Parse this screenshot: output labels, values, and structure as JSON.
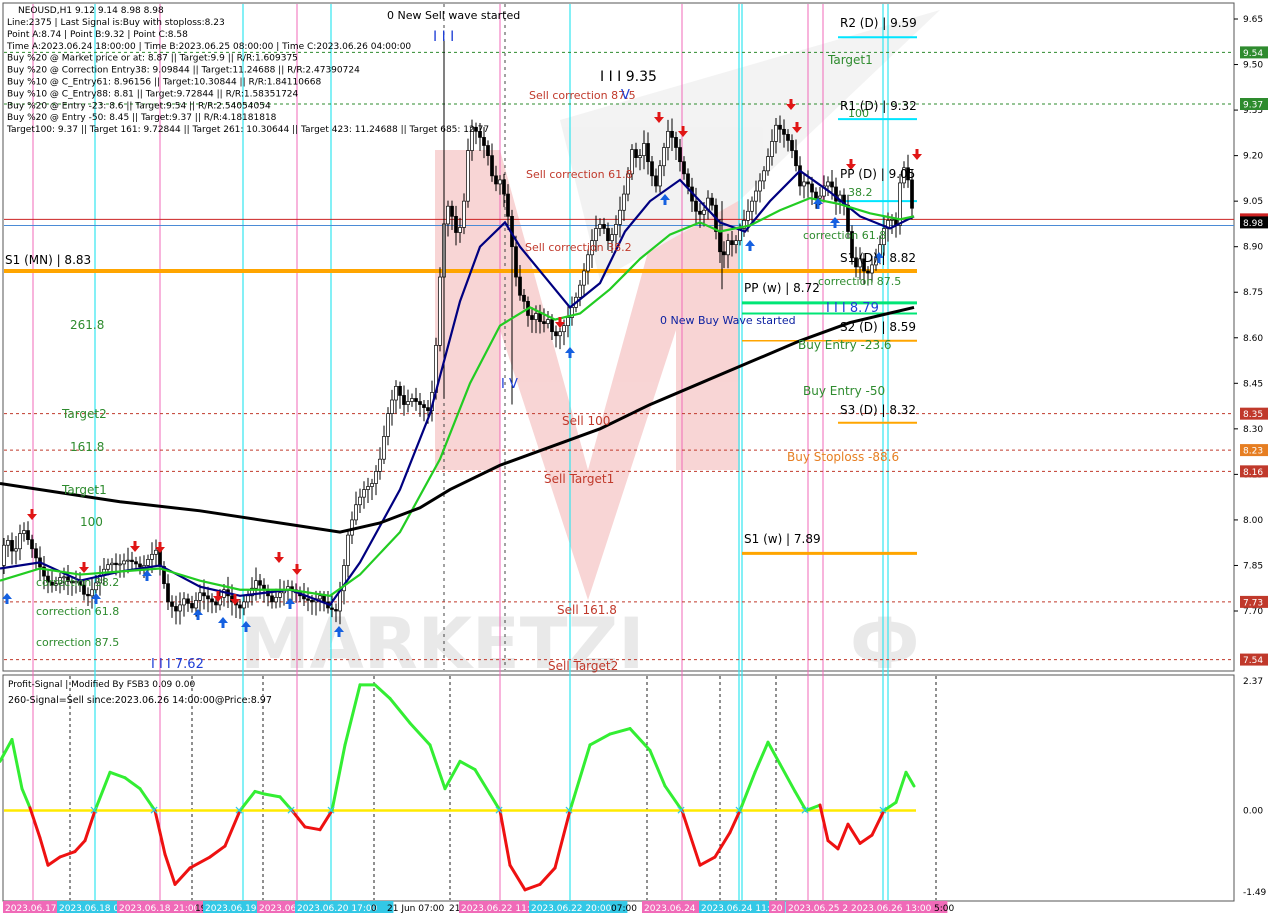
{
  "header": {
    "title": "NEOUSD,H1  9.12 9.14 8.98 8.98",
    "lines": [
      "Line:2375  | Last Signal is:Buy with stoploss:8.23",
      "Point A:8.74 | Point B:9.32 | Point C:8.58",
      "Time A:2023.06.24 18:00:00 | Time B:2023.06.25 08:00:00 | Time C:2023.06.26 04:00:00",
      "Buy %20 @ Market price or at: 8.87 || Target:9.9 || R/R:1.609375",
      "Buy %20 @ Correction Entry38: 9.09844 || Target:11.24688 || R/R:2.47390724",
      "Buy %10 @ C_Entry61: 8.96156 || Target:10.30844 || R/R:1.84110668",
      "Buy %10 @ C_Entry88: 8.81 || Target:9.72844 || R/R:1.58351724",
      "Buy %20 @ Entry -23: 8.6 || Target:9.54 || R/R:2.54054054",
      "Buy %20 @ Entry -50: 8.45 || Target:9.37 || R/R:4.18181818",
      "Target100: 9.37 || Target 161: 9.72844 || Target 261: 10.30644 || Target 423: 11.24688 || Target 685: 12.77"
    ]
  },
  "price_axis": {
    "ticks": [
      "9.65",
      "9.50",
      "9.35",
      "9.20",
      "9.05",
      "8.90",
      "8.75",
      "8.60",
      "8.45",
      "8.30",
      "8.15",
      "8.00",
      "7.85",
      "7.70"
    ],
    "badges": [
      {
        "label": "9.54",
        "value": 9.54,
        "color": "#2e8b2e"
      },
      {
        "label": "9.37",
        "value": 9.37,
        "color": "#2e8b2e"
      },
      {
        "label": "8.99",
        "value": 8.99,
        "color": "#cc2222"
      },
      {
        "label": "8.98",
        "value": 8.98,
        "color": "#000000"
      },
      {
        "label": "8.35",
        "value": 8.35,
        "color": "#c0392b"
      },
      {
        "label": "8.23",
        "value": 8.23,
        "color": "#e67e22"
      },
      {
        "label": "8.16",
        "value": 8.16,
        "color": "#c0392b"
      },
      {
        "label": "7.73",
        "value": 7.73,
        "color": "#c0392b"
      },
      {
        "label": "7.54",
        "value": 7.54,
        "color": "#c0392b"
      }
    ]
  },
  "level_lines": [
    {
      "label": "S1 (MN) | 8.83",
      "value": 8.82,
      "color": "#ffa500",
      "width": 4
    },
    {
      "label": "PP (w) | 8.72",
      "value": 8.715,
      "color": "#00e676",
      "width": 3
    },
    {
      "label": "S1 (w) | 7.89",
      "value": 7.89,
      "color": "#ffa500",
      "width": 3
    },
    {
      "label": "R2 (D) | 9.59",
      "value": 9.59,
      "color": "#00e5ff",
      "width": 2
    },
    {
      "label": "R1 (D) | 9.32",
      "value": 9.32,
      "color": "#00e5ff",
      "width": 2
    },
    {
      "label": "PP (D) | 9.05",
      "value": 9.05,
      "color": "#00e5ff",
      "width": 2
    },
    {
      "label": "S2 (D) | 8.59",
      "value": 8.59,
      "color": "#ffa500",
      "width": 2
    },
    {
      "label": "S3 (D) | 8.32",
      "value": 8.32,
      "color": "#ffa500",
      "width": 2
    }
  ],
  "annotations": {
    "left": [
      "Target2",
      "161.8",
      "Target1",
      "100",
      "261.8",
      "correction 38.2",
      "correction 61.8",
      "correction 87.5"
    ],
    "sell": [
      "Sell correction 87.5",
      "Sell correction 61.8",
      "Sell correction 38.2",
      "Sell 100",
      "Sell Target1",
      "Sell 161.8",
      "Sell Target2"
    ],
    "buy": [
      "Target1",
      "Buy Entry -23.6",
      "Buy Entry -50",
      "Buy Stoploss -88.6",
      "correction 61.8",
      "correction 87.5",
      "100",
      "38.2"
    ],
    "waves": [
      "0 New Sell wave started",
      "0 New Buy Wave started",
      "I I I",
      "I I I 9.35",
      "I V",
      "I I I 7.62",
      "I I I 8.79",
      "V"
    ],
    "pivot_labels": [
      "R2 (D) | 9.59",
      "R1 (D) | 9.32",
      "PP (D) | 9.05",
      "S1 (D) | 8.82",
      "S2 (D) | 8.59",
      "S3 (D) | 8.32",
      "S1 (MN) | 8.83",
      "PP (w) | 8.72",
      "S1 (w) | 7.89"
    ]
  },
  "indicator": {
    "title": "Profit-Signal | Modified By FSB3 0.09 0.00",
    "subtitle": "260-Signal=Sell since:2023.06.26 14:00:00@Price:8.97",
    "ticks": [
      "2.37",
      "0.00",
      "-1.49"
    ]
  },
  "time_axis": {
    "labels": [
      "2023.06.17 14:",
      "2023.06.18 0",
      "2023.06.18 21:00",
      "19",
      "2023.06.19",
      "2023.06",
      "2023.06.20 17:00",
      "0",
      "21 Jun 07:00",
      "21",
      "2023.06.22 11:00",
      "2023.06.22 20:00",
      "07:00",
      "2023.06.24",
      "2023.06.24 11:",
      "20",
      "2023.06.25 2",
      "2023.06.26 13:00",
      "5:00"
    ]
  },
  "chart_data": {
    "type": "candlestick",
    "symbol": "NEOUSD",
    "timeframe": "H1",
    "ylim": [
      7.52,
      9.72
    ],
    "ohlc_last": {
      "open": 9.12,
      "high": 9.14,
      "low": 8.98,
      "close": 8.98
    },
    "close_path": [
      [
        0,
        7.85
      ],
      [
        6,
        7.95
      ],
      [
        14,
        7.88
      ],
      [
        22,
        7.98
      ],
      [
        30,
        7.92
      ],
      [
        38,
        7.86
      ],
      [
        46,
        7.8
      ],
      [
        54,
        7.78
      ],
      [
        62,
        7.82
      ],
      [
        70,
        7.79
      ],
      [
        78,
        7.8
      ],
      [
        86,
        7.74
      ],
      [
        94,
        7.78
      ],
      [
        102,
        7.83
      ],
      [
        110,
        7.86
      ],
      [
        118,
        7.85
      ],
      [
        126,
        7.87
      ],
      [
        134,
        7.86
      ],
      [
        142,
        7.84
      ],
      [
        150,
        7.88
      ],
      [
        156,
        7.9
      ],
      [
        162,
        7.82
      ],
      [
        168,
        7.73
      ],
      [
        176,
        7.7
      ],
      [
        184,
        7.74
      ],
      [
        192,
        7.71
      ],
      [
        200,
        7.76
      ],
      [
        208,
        7.74
      ],
      [
        216,
        7.72
      ],
      [
        224,
        7.77
      ],
      [
        232,
        7.73
      ],
      [
        240,
        7.71
      ],
      [
        248,
        7.75
      ],
      [
        256,
        7.8
      ],
      [
        264,
        7.77
      ],
      [
        272,
        7.73
      ],
      [
        280,
        7.76
      ],
      [
        288,
        7.78
      ],
      [
        296,
        7.76
      ],
      [
        304,
        7.74
      ],
      [
        312,
        7.73
      ],
      [
        320,
        7.75
      ],
      [
        328,
        7.71
      ],
      [
        336,
        7.7
      ],
      [
        342,
        7.8
      ],
      [
        348,
        7.95
      ],
      [
        356,
        8.05
      ],
      [
        364,
        8.1
      ],
      [
        372,
        8.12
      ],
      [
        380,
        8.2
      ],
      [
        388,
        8.35
      ],
      [
        396,
        8.44
      ],
      [
        404,
        8.38
      ],
      [
        412,
        8.4
      ],
      [
        420,
        8.38
      ],
      [
        428,
        8.36
      ],
      [
        434,
        8.45
      ],
      [
        438,
        8.7
      ],
      [
        442,
        8.9
      ],
      [
        446,
        9.05
      ],
      [
        452,
        9.0
      ],
      [
        458,
        8.92
      ],
      [
        464,
        9.05
      ],
      [
        470,
        9.3
      ],
      [
        476,
        9.28
      ],
      [
        482,
        9.25
      ],
      [
        488,
        9.2
      ],
      [
        494,
        9.1
      ],
      [
        500,
        9.12
      ],
      [
        506,
        9.05
      ],
      [
        512,
        8.9
      ],
      [
        518,
        8.75
      ],
      [
        524,
        8.72
      ],
      [
        530,
        8.65
      ],
      [
        536,
        8.68
      ],
      [
        542,
        8.64
      ],
      [
        548,
        8.66
      ],
      [
        554,
        8.6
      ],
      [
        560,
        8.62
      ],
      [
        566,
        8.65
      ],
      [
        572,
        8.7
      ],
      [
        578,
        8.75
      ],
      [
        584,
        8.82
      ],
      [
        590,
        8.9
      ],
      [
        596,
        8.96
      ],
      [
        602,
        8.98
      ],
      [
        608,
        8.92
      ],
      [
        614,
        8.95
      ],
      [
        620,
        9.02
      ],
      [
        626,
        9.1
      ],
      [
        632,
        9.22
      ],
      [
        638,
        9.18
      ],
      [
        644,
        9.24
      ],
      [
        650,
        9.15
      ],
      [
        656,
        9.1
      ],
      [
        662,
        9.2
      ],
      [
        668,
        9.28
      ],
      [
        674,
        9.25
      ],
      [
        680,
        9.18
      ],
      [
        686,
        9.12
      ],
      [
        692,
        9.05
      ],
      [
        698,
        9.0
      ],
      [
        704,
        9.02
      ],
      [
        710,
        9.08
      ],
      [
        716,
        8.95
      ],
      [
        722,
        8.85
      ],
      [
        728,
        8.92
      ],
      [
        734,
        8.9
      ],
      [
        740,
        8.96
      ],
      [
        746,
        9.0
      ],
      [
        752,
        9.05
      ],
      [
        758,
        9.1
      ],
      [
        764,
        9.15
      ],
      [
        770,
        9.22
      ],
      [
        776,
        9.3
      ],
      [
        782,
        9.28
      ],
      [
        788,
        9.25
      ],
      [
        794,
        9.2
      ],
      [
        800,
        9.1
      ],
      [
        806,
        9.12
      ],
      [
        812,
        9.08
      ],
      [
        818,
        9.05
      ],
      [
        824,
        9.1
      ],
      [
        830,
        9.12
      ],
      [
        836,
        9.05
      ],
      [
        842,
        9.08
      ],
      [
        848,
        8.95
      ],
      [
        854,
        8.82
      ],
      [
        860,
        8.86
      ],
      [
        866,
        8.8
      ],
      [
        872,
        8.84
      ],
      [
        878,
        8.88
      ],
      [
        884,
        8.96
      ],
      [
        890,
        9.0
      ],
      [
        896,
        8.97
      ],
      [
        902,
        9.18
      ],
      [
        908,
        9.12
      ],
      [
        914,
        8.98
      ]
    ],
    "series": [
      {
        "name": "",
        "color": "#000080",
        "values": [
          [
            0,
            7.84
          ],
          [
            40,
            7.86
          ],
          [
            80,
            7.8
          ],
          [
            120,
            7.83
          ],
          [
            160,
            7.85
          ],
          [
            200,
            7.78
          ],
          [
            240,
            7.75
          ],
          [
            290,
            7.77
          ],
          [
            330,
            7.72
          ],
          [
            360,
            7.86
          ],
          [
            400,
            8.1
          ],
          [
            430,
            8.35
          ],
          [
            460,
            8.72
          ],
          [
            480,
            8.9
          ],
          [
            505,
            8.98
          ],
          [
            520,
            8.9
          ],
          [
            545,
            8.8
          ],
          [
            570,
            8.7
          ],
          [
            600,
            8.78
          ],
          [
            625,
            8.95
          ],
          [
            650,
            9.05
          ],
          [
            680,
            9.12
          ],
          [
            700,
            9.05
          ],
          [
            720,
            8.98
          ],
          [
            745,
            8.95
          ],
          [
            770,
            9.05
          ],
          [
            800,
            9.15
          ],
          [
            830,
            9.08
          ],
          [
            860,
            9.0
          ],
          [
            890,
            8.96
          ],
          [
            914,
            9.0
          ]
        ]
      },
      {
        "name": "",
        "color": "#22cc22",
        "values": [
          [
            0,
            7.8
          ],
          [
            40,
            7.84
          ],
          [
            80,
            7.82
          ],
          [
            120,
            7.83
          ],
          [
            160,
            7.84
          ],
          [
            200,
            7.8
          ],
          [
            240,
            7.77
          ],
          [
            290,
            7.77
          ],
          [
            330,
            7.75
          ],
          [
            360,
            7.82
          ],
          [
            400,
            7.96
          ],
          [
            440,
            8.2
          ],
          [
            470,
            8.45
          ],
          [
            500,
            8.64
          ],
          [
            530,
            8.7
          ],
          [
            555,
            8.66
          ],
          [
            580,
            8.68
          ],
          [
            610,
            8.76
          ],
          [
            640,
            8.86
          ],
          [
            670,
            8.94
          ],
          [
            700,
            8.98
          ],
          [
            720,
            8.95
          ],
          [
            750,
            8.97
          ],
          [
            780,
            9.02
          ],
          [
            810,
            9.06
          ],
          [
            840,
            9.04
          ],
          [
            870,
            9.01
          ],
          [
            900,
            8.99
          ],
          [
            914,
            9.0
          ]
        ]
      },
      {
        "name": "",
        "color": "#000000",
        "values": [
          [
            0,
            8.12
          ],
          [
            60,
            8.09
          ],
          [
            120,
            8.06
          ],
          [
            200,
            8.03
          ],
          [
            260,
            8.0
          ],
          [
            300,
            7.98
          ],
          [
            340,
            7.96
          ],
          [
            380,
            7.99
          ],
          [
            420,
            8.04
          ],
          [
            450,
            8.1
          ],
          [
            500,
            8.18
          ],
          [
            550,
            8.24
          ],
          [
            600,
            8.3
          ],
          [
            650,
            8.38
          ],
          [
            700,
            8.45
          ],
          [
            750,
            8.52
          ],
          [
            800,
            8.59
          ],
          [
            850,
            8.65
          ],
          [
            914,
            8.7
          ]
        ]
      }
    ],
    "indicator_series": {
      "ylim": [
        -1.49,
        2.37
      ],
      "values": [
        [
          0,
          0.9
        ],
        [
          12,
          1.3
        ],
        [
          22,
          0.4
        ],
        [
          30,
          0.05
        ],
        [
          40,
          -0.5
        ],
        [
          48,
          -1.0
        ],
        [
          60,
          -0.85
        ],
        [
          75,
          -0.75
        ],
        [
          85,
          -0.55
        ],
        [
          95,
          0.0
        ],
        [
          110,
          0.7
        ],
        [
          125,
          0.6
        ],
        [
          140,
          0.4
        ],
        [
          155,
          0.0
        ],
        [
          165,
          -0.8
        ],
        [
          175,
          -1.35
        ],
        [
          190,
          -1.05
        ],
        [
          210,
          -0.85
        ],
        [
          225,
          -0.65
        ],
        [
          240,
          0.0
        ],
        [
          255,
          0.35
        ],
        [
          265,
          0.3
        ],
        [
          280,
          0.25
        ],
        [
          292,
          0.0
        ],
        [
          305,
          -0.3
        ],
        [
          320,
          -0.35
        ],
        [
          332,
          0.0
        ],
        [
          345,
          1.2
        ],
        [
          360,
          2.3
        ],
        [
          375,
          2.3
        ],
        [
          390,
          2.05
        ],
        [
          410,
          1.6
        ],
        [
          430,
          1.2
        ],
        [
          445,
          0.4
        ],
        [
          460,
          0.9
        ],
        [
          475,
          0.75
        ],
        [
          490,
          0.3
        ],
        [
          500,
          0.0
        ],
        [
          510,
          -1.0
        ],
        [
          525,
          -1.45
        ],
        [
          540,
          -1.35
        ],
        [
          555,
          -1.05
        ],
        [
          570,
          0.0
        ],
        [
          590,
          1.2
        ],
        [
          610,
          1.4
        ],
        [
          630,
          1.5
        ],
        [
          650,
          1.1
        ],
        [
          665,
          0.45
        ],
        [
          682,
          0.0
        ],
        [
          700,
          -1.0
        ],
        [
          715,
          -0.85
        ],
        [
          730,
          -0.4
        ],
        [
          740,
          0.0
        ],
        [
          755,
          0.7
        ],
        [
          768,
          1.25
        ],
        [
          780,
          0.85
        ],
        [
          795,
          0.35
        ],
        [
          806,
          0.0
        ],
        [
          820,
          0.1
        ],
        [
          828,
          -0.55
        ],
        [
          838,
          -0.7
        ],
        [
          848,
          -0.25
        ],
        [
          860,
          -0.6
        ],
        [
          872,
          -0.45
        ],
        [
          884,
          0.0
        ],
        [
          896,
          0.15
        ],
        [
          906,
          0.7
        ],
        [
          914,
          0.45
        ]
      ]
    }
  }
}
